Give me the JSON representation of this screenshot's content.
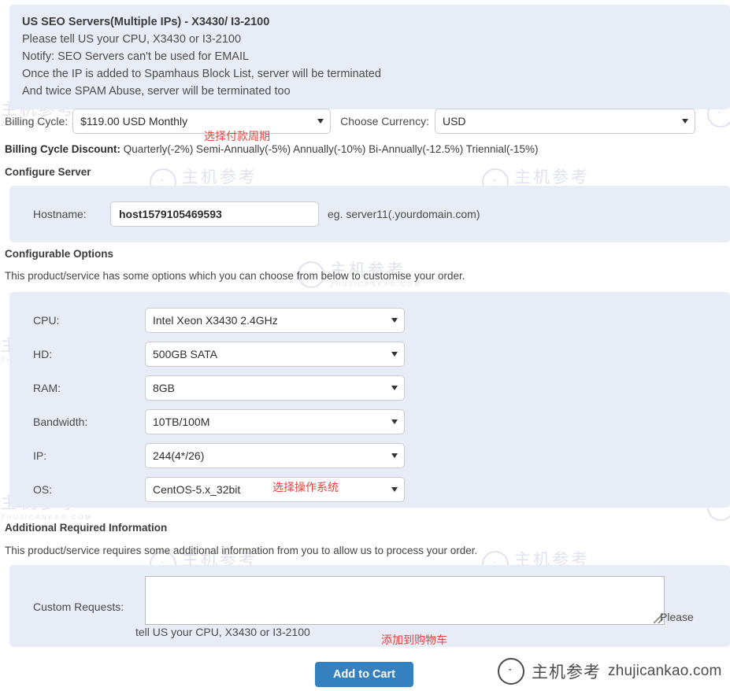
{
  "colors": {
    "panel_bg": "#e8ecf7",
    "accent_button": "#3580bf",
    "annotation_red": "#e8413c",
    "watermark": "#9aa4c4"
  },
  "product_header": {
    "title": "US SEO Servers(Multiple IPs) - X3430/ I3-2100",
    "lines": [
      "Please tell US your CPU, X3430 or I3-2100",
      "Notify: SEO Servers can't be used for EMAIL",
      "Once the IP is added to Spamhaus Block List, server will be terminated",
      "And twice SPAM Abuse, server will be terminated too"
    ]
  },
  "billing": {
    "cycle_label": "Billing Cycle:",
    "cycle_value": "$119.00 USD Monthly",
    "currency_label": "Choose Currency:",
    "currency_value": "USD",
    "discount_label": "Billing Cycle Discount:",
    "discount_value": "Quarterly(-2%) Semi-Annually(-5%) Annually(-10%) Bi-Annually(-12.5%) Triennial(-15%)"
  },
  "configure_server": {
    "heading": "Configure Server",
    "hostname_label": "Hostname:",
    "hostname_value": "host1579105469593",
    "hostname_hint": "eg. server11(.yourdomain.com)"
  },
  "configurable_options": {
    "heading": "Configurable Options",
    "description": "This product/service has some options which you can choose from below to customise your order.",
    "rows": [
      {
        "label": "CPU:",
        "value": "Intel Xeon X3430 2.4GHz"
      },
      {
        "label": "HD:",
        "value": "500GB SATA"
      },
      {
        "label": "RAM:",
        "value": "8GB"
      },
      {
        "label": "Bandwidth:",
        "value": "10TB/100M"
      },
      {
        "label": "IP:",
        "value": "244(4*/26)"
      },
      {
        "label": "OS:",
        "value": "CentOS-5.x_32bit"
      }
    ]
  },
  "additional_info": {
    "heading": "Additional Required Information",
    "description": "This product/service requires some additional information from you to allow us to process your order.",
    "custom_label": "Custom Requests:",
    "custom_value": "",
    "hint_right": "Please",
    "hint_below": "tell US your CPU, X3430 or I3-2100"
  },
  "actions": {
    "add_to_cart": "Add to Cart"
  },
  "annotations": {
    "billing": "选择付款周期",
    "os": "选择操作系统",
    "cart": "添加到购物车"
  },
  "brand": {
    "cn": "主机参考",
    "en": "zhujicankao.com",
    "wm_cn": "主机参考",
    "wm_en": "ZHUJICANKAO.COM"
  }
}
